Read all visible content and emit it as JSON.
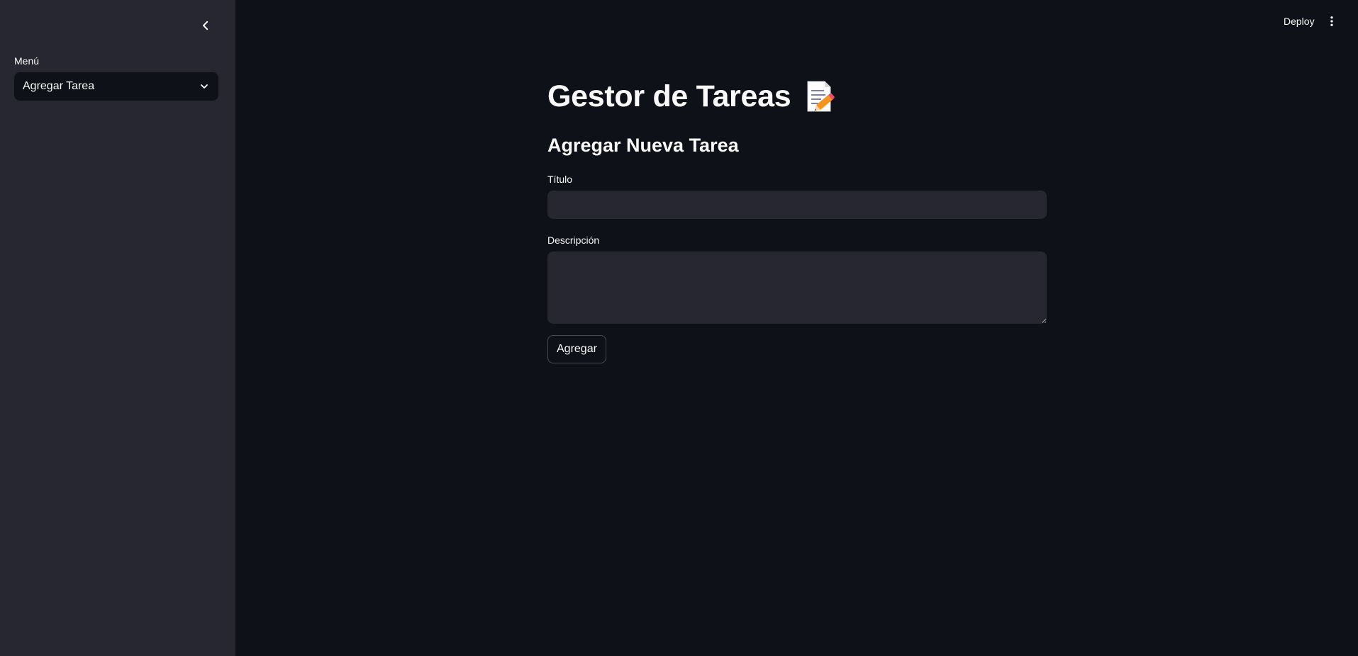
{
  "sidebar": {
    "collapse_icon": "chevron-left-icon",
    "menu_label": "Menú",
    "menu_selected": "Agregar Tarea",
    "menu_chevron_icon": "chevron-down-icon"
  },
  "header": {
    "deploy_label": "Deploy",
    "menu_icon": "vertical-dots-icon"
  },
  "main": {
    "title": "Gestor de Tareas",
    "title_icon": "memo-icon",
    "subheader": "Agregar Nueva Tarea",
    "fields": {
      "title_label": "Título",
      "title_value": "",
      "description_label": "Descripción",
      "description_value": ""
    },
    "submit_label": "Agregar"
  },
  "colors": {
    "background": "#0e1117",
    "sidebar": "#262730",
    "input": "#262730",
    "text": "#fafafa"
  }
}
